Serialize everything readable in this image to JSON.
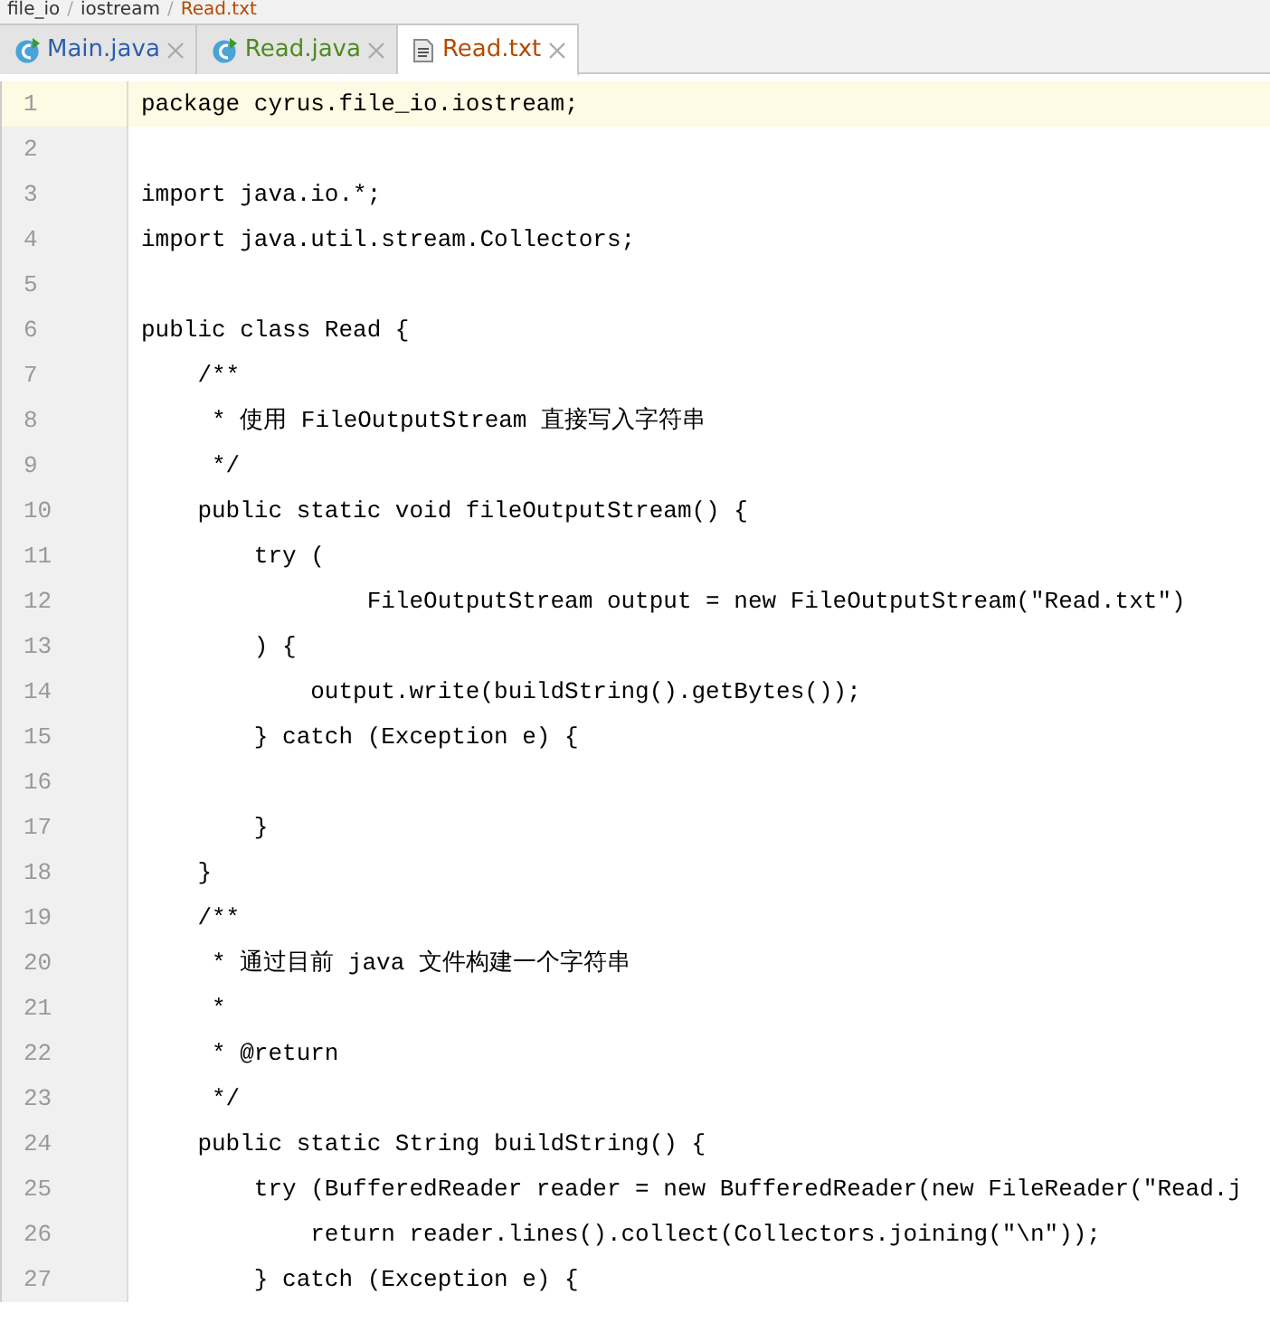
{
  "breadcrumb": [
    {
      "label": "file_io"
    },
    {
      "separator": "/",
      "label": "iostream"
    },
    {
      "separator": "/",
      "label": "Read.txt"
    }
  ],
  "tabs": [
    {
      "label": "Main.java",
      "kind": "class",
      "color": "#2a5db0",
      "selected": false
    },
    {
      "label": "Read.java",
      "kind": "class",
      "color": "#4e8a1f",
      "selected": false
    },
    {
      "label": "Read.txt",
      "kind": "text",
      "color": "#b54a00",
      "selected": true
    }
  ],
  "lines": [
    {
      "number": "1",
      "text": "package cyrus.file_io.iostream;",
      "current": true
    },
    {
      "number": "2",
      "current": false
    },
    {
      "number": "3",
      "text": "import java.io.*;",
      "current": false
    },
    {
      "number": "4",
      "text": "import java.util.stream.Collectors;",
      "current": false
    },
    {
      "number": "5",
      "current": false
    },
    {
      "number": "6",
      "text": "public class Read {",
      "current": false
    },
    {
      "number": "7",
      "text": "    /**",
      "current": false
    },
    {
      "number": "8",
      "text": "     * 使用 FileOutputStream 直接写入字符串",
      "current": false
    },
    {
      "number": "9",
      "text": "     */",
      "current": false
    },
    {
      "number": "10",
      "text": "    public static void fileOutputStream() {",
      "current": false
    },
    {
      "number": "11",
      "text": "        try (",
      "current": false
    },
    {
      "number": "12",
      "text": "                FileOutputStream output = new FileOutputStream(\"Read.txt\")",
      "current": false
    },
    {
      "number": "13",
      "text": "        ) {",
      "current": false
    },
    {
      "number": "14",
      "text": "            output.write(buildString().getBytes());",
      "current": false
    },
    {
      "number": "15",
      "text": "        } catch (Exception e) {",
      "current": false
    },
    {
      "number": "16",
      "current": false
    },
    {
      "number": "17",
      "text": "        }",
      "current": false
    },
    {
      "number": "18",
      "text": "    }",
      "current": false
    },
    {
      "number": "19",
      "text": "    /**",
      "current": false
    },
    {
      "number": "20",
      "text": "     * 通过目前 java 文件构建一个字符串",
      "current": false
    },
    {
      "number": "21",
      "text": "     *",
      "current": false
    },
    {
      "number": "22",
      "text": "     * @return",
      "current": false
    },
    {
      "number": "23",
      "text": "     */",
      "current": false
    },
    {
      "number": "24",
      "text": "    public static String buildString() {",
      "current": false
    },
    {
      "number": "25",
      "text": "        try (BufferedReader reader = new BufferedReader(new FileReader(\"Read.j",
      "current": false
    },
    {
      "number": "26",
      "text": "            return reader.lines().collect(Collectors.joining(\"\\n\"));",
      "current": false
    },
    {
      "number": "27",
      "text": "        } catch (Exception e) {",
      "current": false
    }
  ]
}
